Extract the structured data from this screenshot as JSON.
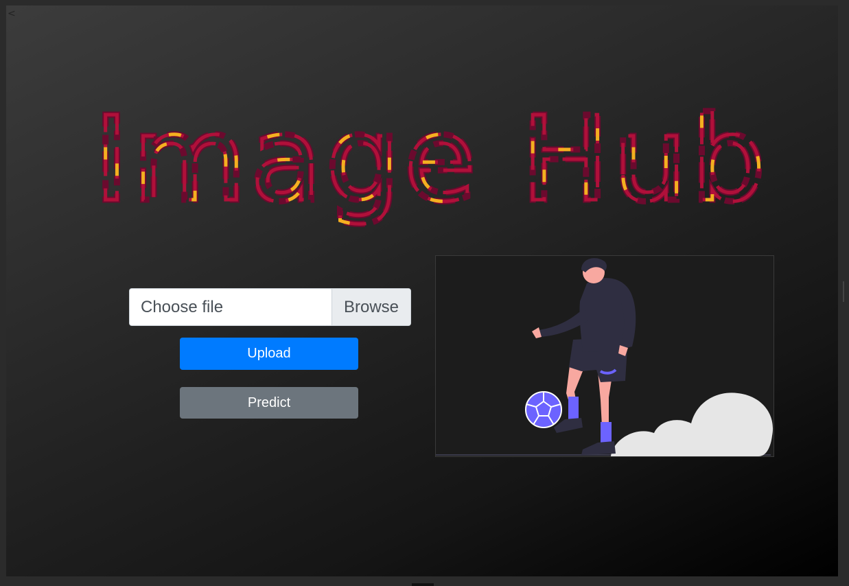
{
  "nav": {
    "back_label": "<"
  },
  "header": {
    "title": "Image Hub"
  },
  "form": {
    "file_placeholder": "Choose file",
    "browse_label": "Browse",
    "upload_label": "Upload",
    "predict_label": "Predict"
  },
  "colors": {
    "upload_button": "#007bff",
    "predict_button": "#6c757d",
    "title_red": "#b0103a",
    "title_maroon": "#6b0a2e",
    "title_yellow": "#f4b020",
    "accent_purple": "#6c63ff"
  },
  "illustration": {
    "icon": "football-player-icon"
  }
}
